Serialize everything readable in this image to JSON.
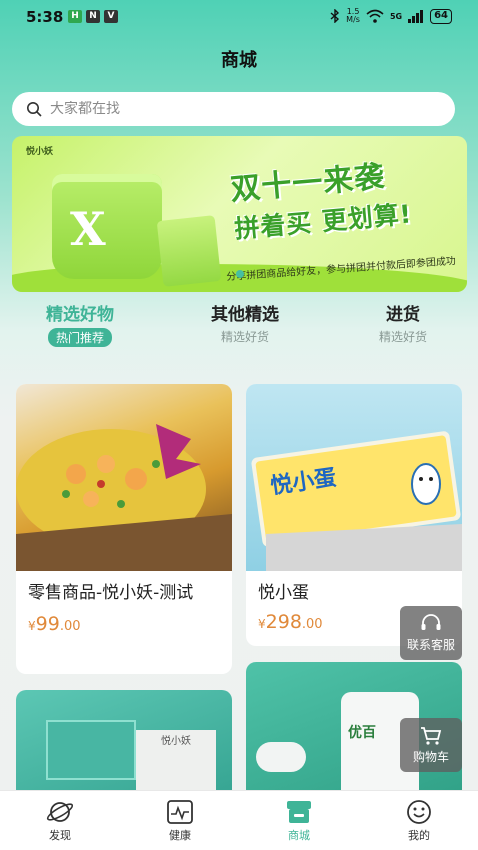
{
  "status_bar": {
    "time": "5:38",
    "left_icons": [
      "H",
      "N",
      "V"
    ],
    "net_speed_top": "1.5",
    "net_speed_bottom": "M/s",
    "network": "5G",
    "battery": "64"
  },
  "header": {
    "title": "商城"
  },
  "search": {
    "placeholder": "大家都在找"
  },
  "banner": {
    "brand": "悦小妖",
    "title_line1": "双十一来袭",
    "title_line2": "拼着买 更划算!",
    "subtitle": "分享拼团商品给好友，参与拼团并付款后即参团成功",
    "product_text": "X figure"
  },
  "tabs": [
    {
      "label": "精选好物",
      "sub": "热门推荐",
      "active": true
    },
    {
      "label": "其他精选",
      "sub": "精选好货",
      "active": false
    },
    {
      "label": "进货",
      "sub": "精选好货",
      "active": false
    }
  ],
  "products": [
    {
      "name": "零售商品-悦小妖-测试",
      "currency": "¥",
      "price_int": "99",
      "price_dec": ".00"
    },
    {
      "name": "悦小蛋",
      "currency": "¥",
      "price_int": "298",
      "price_dec": ".00",
      "image_text": "悦小蛋"
    },
    {
      "name": "",
      "image_text": "悦小妖"
    },
    {
      "name": "",
      "image_text": "优百"
    }
  ],
  "floating": {
    "service_label": "联系客服",
    "cart_label": "购物车"
  },
  "bottom_nav": [
    {
      "label": "发现",
      "icon": "planet-icon",
      "active": false
    },
    {
      "label": "健康",
      "icon": "heart-rate-icon",
      "active": false
    },
    {
      "label": "商城",
      "icon": "store-icon",
      "active": true
    },
    {
      "label": "我的",
      "icon": "smiley-icon",
      "active": false
    }
  ],
  "colors": {
    "accent": "#3fb497",
    "price": "#e0893a"
  }
}
